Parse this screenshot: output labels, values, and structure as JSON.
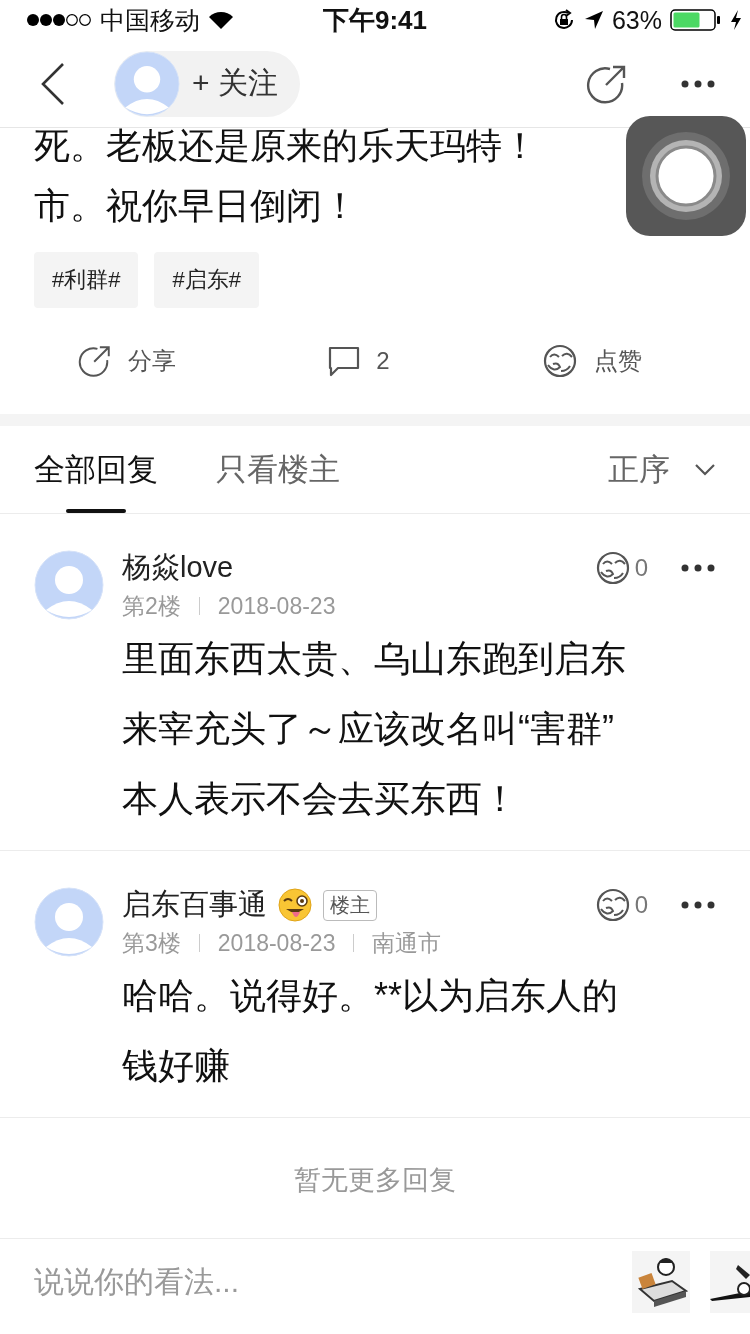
{
  "status_bar": {
    "carrier": "中国移动",
    "time": "下午9:41",
    "battery": "63%"
  },
  "nav": {
    "follow": "+ 关注"
  },
  "post": {
    "lines": [
      "死。老板还是原来的乐天玛特！",
      "市。祝你早日倒闭！"
    ],
    "tags": [
      "#利群#",
      "#启东#"
    ],
    "actions": [
      {
        "kind": "share",
        "label": "分享"
      },
      {
        "kind": "comment",
        "label": "2"
      },
      {
        "kind": "like",
        "label": "点赞"
      }
    ]
  },
  "tabs": [
    {
      "label": "全部回复",
      "selected": true
    },
    {
      "label": "只看楼主",
      "selected": false
    }
  ],
  "sort": {
    "label": "正序"
  },
  "replies": [
    {
      "name": "杨焱love",
      "emoji": false,
      "floor": "第2楼",
      "date": "2018-08-23",
      "likes": "0",
      "lines": [
        "里面东西太贵、乌山东跑到启东",
        "来宰充头了～应该改名叫“害群”",
        "本人表示不会去买东西！"
      ]
    },
    {
      "name": "启东百事通",
      "emoji": true,
      "badge": "楼主",
      "floor": "第3楼",
      "date": "2018-08-23",
      "location": "南通市",
      "likes": "0",
      "lines": [
        "哈哈。说得好。**以为启东人的",
        "钱好赚"
      ]
    }
  ],
  "end_note": "暂无更多回复",
  "comment_input": {
    "placeholder": "说说你的看法..."
  }
}
